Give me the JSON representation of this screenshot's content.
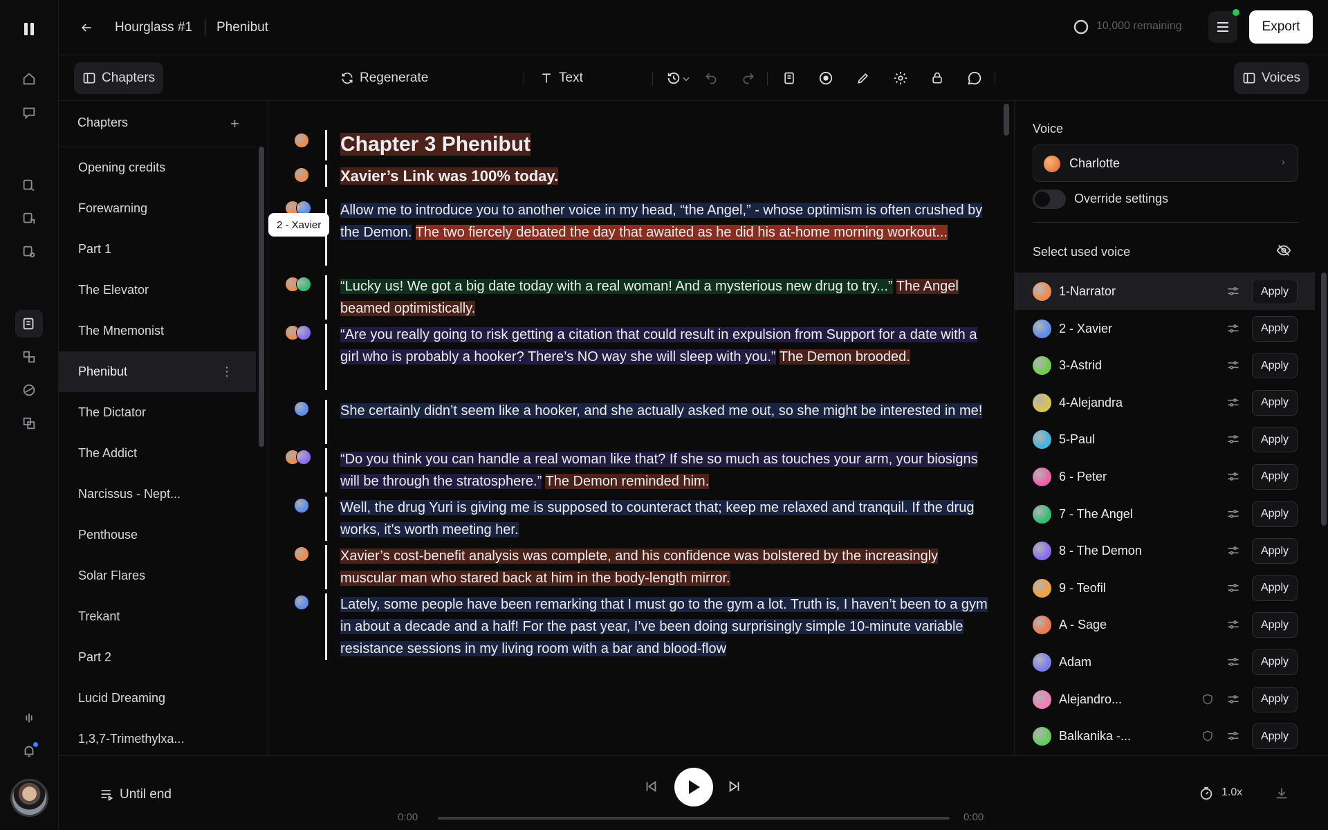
{
  "header": {
    "project": "Hourglass #1",
    "chapter": "Phenibut",
    "remaining": "10,000 remaining",
    "export_label": "Export"
  },
  "toolbar": {
    "chapters_label": "Chapters",
    "regenerate_label": "Regenerate",
    "text_label": "Text",
    "voices_label": "Voices"
  },
  "chapters": {
    "title": "Chapters",
    "items": [
      {
        "label": "Opening credits"
      },
      {
        "label": "Forewarning"
      },
      {
        "label": "Part 1"
      },
      {
        "label": "The Elevator"
      },
      {
        "label": "The Mnemonist"
      },
      {
        "label": "Phenibut",
        "active": true
      },
      {
        "label": "The Dictator"
      },
      {
        "label": "The Addict"
      },
      {
        "label": "Narcissus - Nept..."
      },
      {
        "label": "Penthouse"
      },
      {
        "label": "Solar Flares"
      },
      {
        "label": "Trekant"
      },
      {
        "label": "Part 2"
      },
      {
        "label": "Lucid Dreaming"
      },
      {
        "label": "1,3,7-Trimethylxa..."
      }
    ]
  },
  "editor": {
    "tooltip": "2 - Xavier",
    "blocks": [
      {
        "voices": [
          "narrator"
        ],
        "segments": [
          {
            "t": "Chapter 3 Phenibut",
            "c": "hl-n"
          }
        ],
        "heading": "h1"
      },
      {
        "voices": [
          "narrator"
        ],
        "segments": [
          {
            "t": "Xavier’s Link was 100% today.",
            "c": "hl-n"
          }
        ],
        "heading": "h2"
      },
      {
        "voices": [
          "narrator",
          "xavier"
        ],
        "segments": [
          {
            "t": "Allow me to introduce you to another voice in my head, “the Angel,” - whose optimism is often crushed by the Demon.",
            "c": "hl-x"
          },
          {
            "t": " ",
            "c": ""
          },
          {
            "t": "The two fiercely debated the day that awaited as he did his at-home morning workout...",
            "c": "hl-n2"
          }
        ]
      },
      {
        "voices": [
          "narrator",
          "angel"
        ],
        "segments": [
          {
            "t": "“Lucky us! We got a big date today with a real woman! And a mysterious new drug to try...”",
            "c": "hl-a"
          },
          {
            "t": " ",
            "c": ""
          },
          {
            "t": "The Angel beamed optimistically.",
            "c": "hl-n"
          }
        ]
      },
      {
        "voices": [
          "narrator",
          "demon"
        ],
        "segments": [
          {
            "t": "“Are you really going to risk getting a citation that could result in expulsion from Support for a date with a girl who is probably a hooker? There’s NO way she will sleep with you.”",
            "c": "hl-d"
          },
          {
            "t": " ",
            "c": ""
          },
          {
            "t": "The Demon brooded.",
            "c": "hl-n"
          }
        ]
      },
      {
        "voices": [
          "xavier"
        ],
        "segments": [
          {
            "t": "She certainly didn’t seem like a hooker, and she actually asked me out, so she might be interested in me!",
            "c": "hl-x"
          }
        ]
      },
      {
        "voices": [
          "narrator",
          "demon"
        ],
        "segments": [
          {
            "t": "“Do you think you can handle a real woman like that? If she so much as touches your arm, your biosigns will be through the stratosphere.”",
            "c": "hl-d"
          },
          {
            "t": " ",
            "c": ""
          },
          {
            "t": "The Demon reminded him.",
            "c": "hl-n"
          }
        ]
      },
      {
        "voices": [
          "xavier"
        ],
        "segments": [
          {
            "t": "Well, the drug Yuri is giving me is supposed to counteract that; keep me relaxed and tranquil. If the drug works, it’s worth meeting her.",
            "c": "hl-x"
          }
        ]
      },
      {
        "voices": [
          "narrator"
        ],
        "segments": [
          {
            "t": "Xavier’s cost-benefit analysis was complete, and his confidence was bolstered by the increasingly muscular man who stared back at him in the body-length mirror.",
            "c": "hl-n"
          }
        ]
      },
      {
        "voices": [
          "xavier"
        ],
        "segments": [
          {
            "t": "Lately, some people have been remarking that I must go to the gym a lot. Truth is, I haven’t been to a gym in about a decade and a half! For the past year, I’ve been doing surprisingly simple 10-minute variable resistance sessions in my living room with a bar and blood-flow",
            "c": "hl-x"
          }
        ]
      }
    ]
  },
  "voices_panel": {
    "voice_label": "Voice",
    "selected_voice": "Charlotte",
    "override_label": "Override settings",
    "select_used_label": "Select used voice",
    "apply_label": "Apply",
    "list": [
      {
        "name": "1-Narrator",
        "color": "#f08a4b",
        "active": true
      },
      {
        "name": "2 - Xavier",
        "color": "#5b8def"
      },
      {
        "name": "3-Astrid",
        "color": "#6ccf4a"
      },
      {
        "name": "4-Alejandra",
        "color": "#d8c64a"
      },
      {
        "name": "5-Paul",
        "color": "#3fb4e0"
      },
      {
        "name": "6 - Peter",
        "color": "#ef5fa8"
      },
      {
        "name": "7 - The Angel",
        "color": "#2fbf71"
      },
      {
        "name": "8 - The Demon",
        "color": "#8b6cf0"
      },
      {
        "name": "9 - Teofil",
        "color": "#f59e3b"
      },
      {
        "name": "A - Sage",
        "color": "#f0764b"
      },
      {
        "name": "Adam",
        "color": "#7c7cf2"
      },
      {
        "name": "Alejandro...",
        "color": "#f47ab8",
        "shield": true
      },
      {
        "name": "Balkanika -...",
        "color": "#5fcf5a",
        "shield": true
      }
    ]
  },
  "player": {
    "until_label": "Until end",
    "time_start": "0:00",
    "time_end": "0:00",
    "progress": 0,
    "speed": "1.0x"
  },
  "colors": {
    "narrator": "#f08a4b",
    "xavier": "#5b8def",
    "angel": "#2fbf71",
    "demon": "#8b6cf0"
  }
}
